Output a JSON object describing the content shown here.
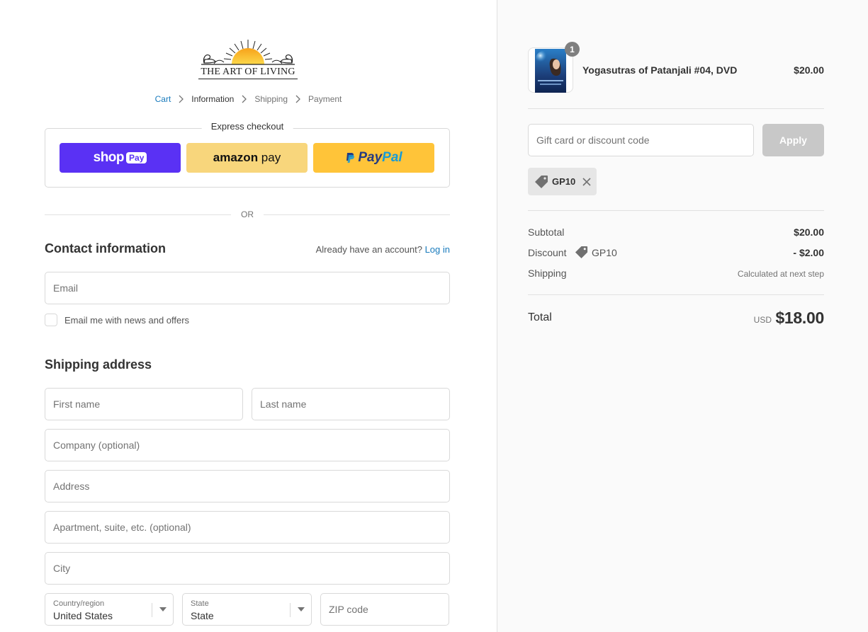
{
  "logo": {
    "text": "THE ART OF LIVING",
    "icon": "sun-swans-logo"
  },
  "breadcrumb": {
    "items": [
      "Cart",
      "Information",
      "Shipping",
      "Payment"
    ],
    "current": "Information"
  },
  "express_checkout": {
    "title": "Express checkout",
    "shop_pay": {
      "word": "shop",
      "badge": "Pay",
      "color": "#5a31f4"
    },
    "amazon_pay": {
      "word_a": "amazon",
      "word_b": " pay",
      "color": "#f8d67c"
    },
    "paypal": {
      "word_a": "Pay",
      "word_b": "Pal",
      "color": "#ffc439"
    }
  },
  "divider_text": "OR",
  "contact": {
    "title": "Contact information",
    "login_prompt": "Already have an account?",
    "login_link": "Log in",
    "email_placeholder": "Email",
    "newsletter_label": "Email me with news and offers"
  },
  "shipping": {
    "title": "Shipping address",
    "first_name_placeholder": "First name",
    "last_name_placeholder": "Last name",
    "company_placeholder": "Company (optional)",
    "address_placeholder": "Address",
    "apartment_placeholder": "Apartment, suite, etc. (optional)",
    "city_placeholder": "City",
    "country_label": "Country/region",
    "country_value": "United States",
    "state_label": "State",
    "state_value": "State",
    "zip_placeholder": "ZIP code"
  },
  "order": {
    "product_name": "Yogasutras of Patanjali #04, DVD",
    "product_price": "$20.00",
    "quantity": "1",
    "discount_placeholder": "Gift card or discount code",
    "apply_label": "Apply",
    "applied_code": "GP10",
    "subtotal_label": "Subtotal",
    "subtotal_value": "$20.00",
    "discount_label": "Discount",
    "discount_code": "GP10",
    "discount_value": "- $2.00",
    "shipping_label": "Shipping",
    "shipping_value": "Calculated at next step",
    "total_label": "Total",
    "total_currency": "USD",
    "total_value": "$18.00"
  },
  "colors": {
    "link": "#197bbd",
    "sidebar_bg": "#fafafa",
    "apply_disabled": "#c8c8c8"
  }
}
